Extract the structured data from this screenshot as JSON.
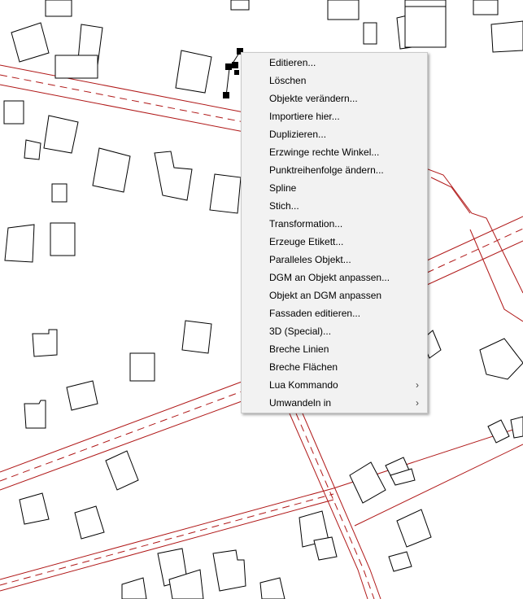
{
  "context_menu": {
    "items": [
      {
        "label": "Editieren...",
        "submenu": false
      },
      {
        "label": "Löschen",
        "submenu": false
      },
      {
        "label": "Objekte verändern...",
        "submenu": false
      },
      {
        "label": "Importiere hier...",
        "submenu": false
      },
      {
        "label": "Duplizieren...",
        "submenu": false
      },
      {
        "label": "Erzwinge rechte Winkel...",
        "submenu": false
      },
      {
        "label": "Punktreihenfolge ändern...",
        "submenu": false
      },
      {
        "label": "Spline",
        "submenu": false
      },
      {
        "label": "Stich...",
        "submenu": false
      },
      {
        "label": "Transformation...",
        "submenu": false
      },
      {
        "label": "Erzeuge Etikett...",
        "submenu": false
      },
      {
        "label": "Paralleles Objekt...",
        "submenu": false
      },
      {
        "label": "DGM an Objekt anpassen...",
        "submenu": false
      },
      {
        "label": "Objekt an DGM anpassen",
        "submenu": false
      },
      {
        "label": "Fassaden editieren...",
        "submenu": false
      },
      {
        "label": "3D (Special)...",
        "submenu": false
      },
      {
        "label": "Breche Linien",
        "submenu": false
      },
      {
        "label": "Breche Flächen",
        "submenu": false
      },
      {
        "label": "Lua Kommando",
        "submenu": true
      },
      {
        "label": "Umwandeln in",
        "submenu": true
      }
    ],
    "submenu_arrow": "›"
  },
  "colors": {
    "road": "#b01818",
    "building_outline": "#000000",
    "menu_background": "#f2f2f2"
  }
}
